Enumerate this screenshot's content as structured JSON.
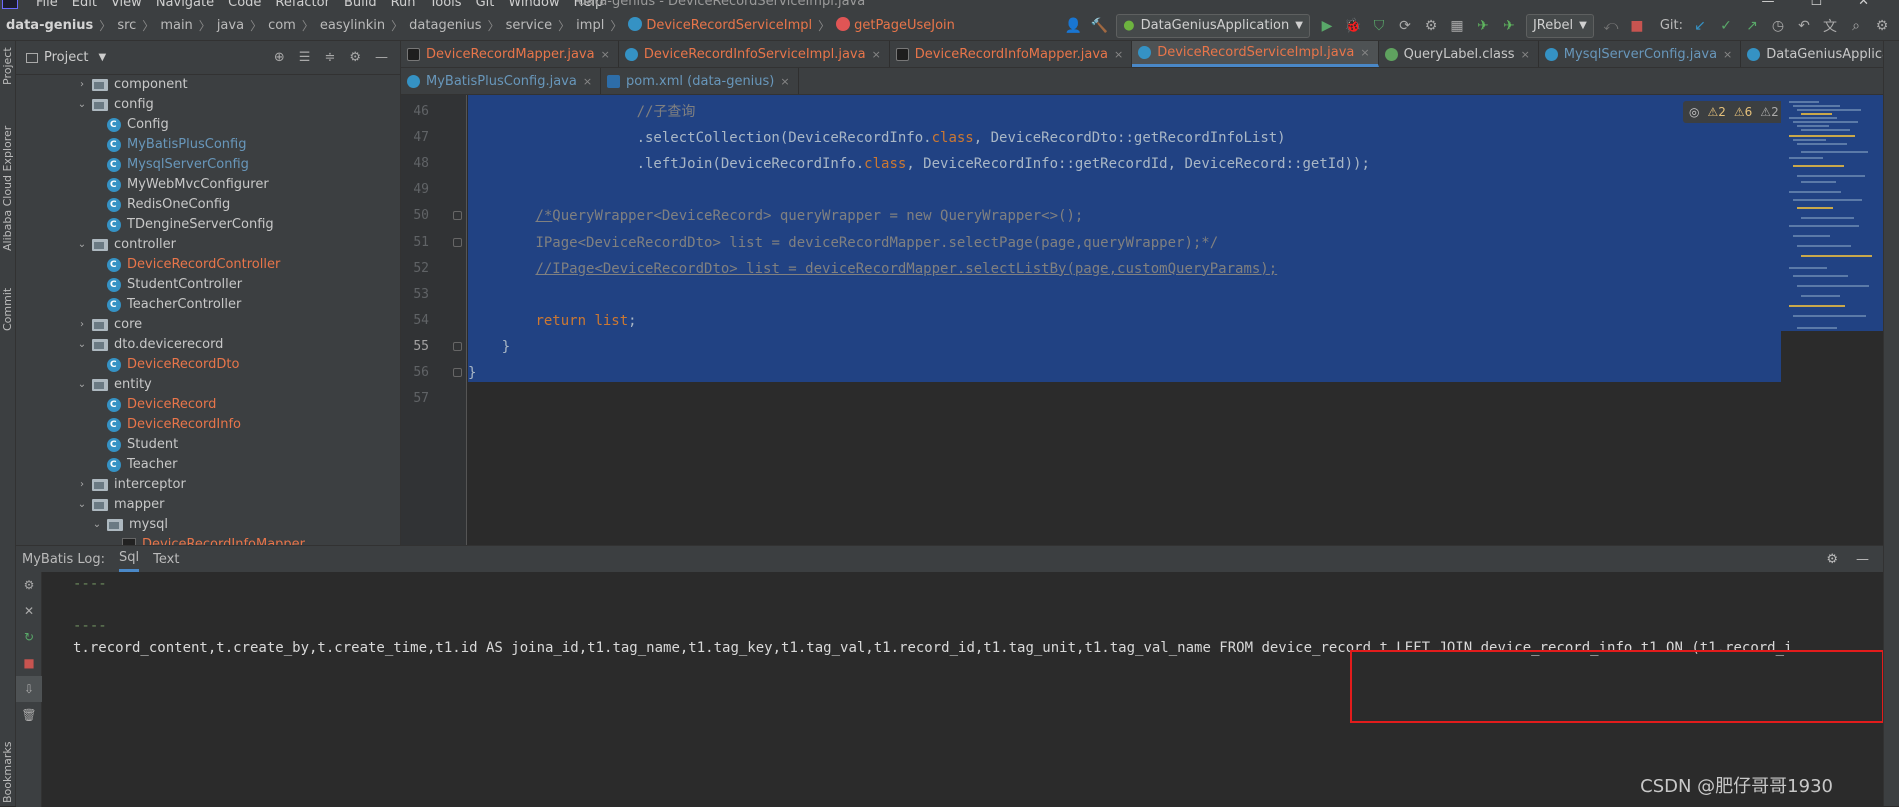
{
  "menu": {
    "items": [
      "File",
      "Edit",
      "View",
      "Navigate",
      "Code",
      "Refactor",
      "Build",
      "Run",
      "Tools",
      "Git",
      "Window",
      "Help"
    ],
    "window_title": "data-genius - DeviceRecordServiceImpl.java"
  },
  "breadcrumb": {
    "items": [
      "data-genius",
      "src",
      "main",
      "java",
      "com",
      "easylinkin",
      "datagenius",
      "service",
      "impl"
    ],
    "class_name": "DeviceRecordServiceImpl",
    "method_name": "getPageUseJoin"
  },
  "toolbar": {
    "run_config": "DataGeniusApplication",
    "jrebel": "JRebel",
    "git_label": "Git:"
  },
  "left_strip": {
    "project": "Project",
    "alibaba": "Alibaba Cloud Explorer",
    "commit": "Commit",
    "bookmarks": "Bookmarks"
  },
  "project_panel": {
    "title": "Project",
    "tree": [
      {
        "label": "component",
        "type": "folder",
        "depth": 1,
        "expanded": false,
        "color": "white"
      },
      {
        "label": "config",
        "type": "folder",
        "depth": 1,
        "expanded": true,
        "color": "white"
      },
      {
        "label": "Config",
        "type": "class",
        "depth": 2,
        "color": "white"
      },
      {
        "label": "MyBatisPlusConfig",
        "type": "class",
        "depth": 2,
        "color": "blue"
      },
      {
        "label": "MysqlServerConfig",
        "type": "class",
        "depth": 2,
        "color": "blue"
      },
      {
        "label": "MyWebMvcConfigurer",
        "type": "class",
        "depth": 2,
        "color": "white"
      },
      {
        "label": "RedisOneConfig",
        "type": "class",
        "depth": 2,
        "color": "white"
      },
      {
        "label": "TDengineServerConfig",
        "type": "class",
        "depth": 2,
        "color": "white"
      },
      {
        "label": "controller",
        "type": "folder",
        "depth": 1,
        "expanded": true,
        "color": "white"
      },
      {
        "label": "DeviceRecordController",
        "type": "class",
        "depth": 2,
        "color": "red"
      },
      {
        "label": "StudentController",
        "type": "class",
        "depth": 2,
        "color": "white"
      },
      {
        "label": "TeacherController",
        "type": "class",
        "depth": 2,
        "color": "white"
      },
      {
        "label": "core",
        "type": "folder",
        "depth": 1,
        "expanded": false,
        "color": "white"
      },
      {
        "label": "dto.devicerecord",
        "type": "folder",
        "depth": 1,
        "expanded": true,
        "color": "white"
      },
      {
        "label": "DeviceRecordDto",
        "type": "class",
        "depth": 2,
        "color": "red"
      },
      {
        "label": "entity",
        "type": "folder",
        "depth": 1,
        "expanded": true,
        "color": "white"
      },
      {
        "label": "DeviceRecord",
        "type": "class",
        "depth": 2,
        "color": "red"
      },
      {
        "label": "DeviceRecordInfo",
        "type": "class",
        "depth": 2,
        "color": "red"
      },
      {
        "label": "Student",
        "type": "class",
        "depth": 2,
        "color": "white"
      },
      {
        "label": "Teacher",
        "type": "class",
        "depth": 2,
        "color": "white"
      },
      {
        "label": "interceptor",
        "type": "folder",
        "depth": 1,
        "expanded": false,
        "color": "white"
      },
      {
        "label": "mapper",
        "type": "folder",
        "depth": 1,
        "expanded": true,
        "color": "white"
      },
      {
        "label": "mysql",
        "type": "folder",
        "depth": 2,
        "expanded": true,
        "color": "white"
      },
      {
        "label": "DeviceRecordInfoMapper",
        "type": "mapper",
        "depth": 3,
        "color": "red"
      }
    ]
  },
  "editor": {
    "tabs_row1": [
      {
        "label": "DeviceRecordMapper.java",
        "icon": "mapper",
        "color": "red",
        "active": false
      },
      {
        "label": "DeviceRecordInfoServiceImpl.java",
        "icon": "class",
        "color": "red",
        "active": false
      },
      {
        "label": "DeviceRecordInfoMapper.java",
        "icon": "mapper",
        "color": "red",
        "active": false
      },
      {
        "label": "DeviceRecordServiceImpl.java",
        "icon": "class",
        "color": "red",
        "active": true
      },
      {
        "label": "QueryLabel.class",
        "icon": "interface",
        "color": "white",
        "active": false
      },
      {
        "label": "MysqlServerConfig.java",
        "icon": "class",
        "color": "blue",
        "active": false
      },
      {
        "label": "DataGeniusApplication.java",
        "icon": "class",
        "color": "white",
        "active": false
      }
    ],
    "tabs_row2": [
      {
        "label": "MyBatisPlusConfig.java",
        "icon": "class",
        "color": "blue",
        "active": false
      },
      {
        "label": "pom.xml (data-genius)",
        "icon": "maven",
        "color": "blue",
        "active": false
      }
    ],
    "inspections": {
      "errors": "2",
      "warnings": "6",
      "weak": "2"
    },
    "lines": [
      {
        "num": "46",
        "html": "                    <span class='cm'>//子查询</span>"
      },
      {
        "num": "47",
        "html": "                    .selectCollection(DeviceRecordInfo.<span class='kw'>class</span>, DeviceRecordDto::getRecordInfoList)"
      },
      {
        "num": "48",
        "html": "                    .leftJoin(DeviceRecordInfo.<span class='kw'>class</span>, DeviceRecordInfo::getRecordId, DeviceRecord::getId));"
      },
      {
        "num": "49",
        "html": ""
      },
      {
        "num": "50",
        "html": "        <span class='cm'><span class='ul'>/*</span>QueryWrapper&lt;DeviceRecord&gt; queryWrapper = new QueryWrapper&lt;&gt;();</span>"
      },
      {
        "num": "51",
        "html": "        <span class='cm'>IPage&lt;DeviceRecordDto&gt; list = deviceRecordMapper.selectPage(page,queryWrapper);*/</span>"
      },
      {
        "num": "52",
        "html": "        <span class='cm ul'>//IPage&lt;DeviceRecordDto&gt; list = deviceRecordMapper.selectListBy(page,customQueryParams);</span>"
      },
      {
        "num": "53",
        "html": ""
      },
      {
        "num": "54",
        "html": "        <span class='kw'>return</span> <span class='kw'>list</span>;"
      },
      {
        "num": "55",
        "html": "    }"
      },
      {
        "num": "56",
        "html": "}"
      },
      {
        "num": "57",
        "html": ""
      }
    ]
  },
  "log": {
    "title": "MyBatis Log:",
    "tabs": [
      "Sql",
      "Text"
    ],
    "active_tab": "Sql",
    "lines": [
      "----",
      "----",
      "t.record_content,t.create_by,t.create_time,t1.id AS joina_id,t1.tag_name,t1.tag_key,t1.tag_val,t1.record_id,t1.tag_unit,t1.tag_val_name FROM device_record t LEFT JOIN device_record_info t1 ON (t1.record_i"
    ]
  },
  "watermark": "CSDN @肥仔哥哥1930"
}
